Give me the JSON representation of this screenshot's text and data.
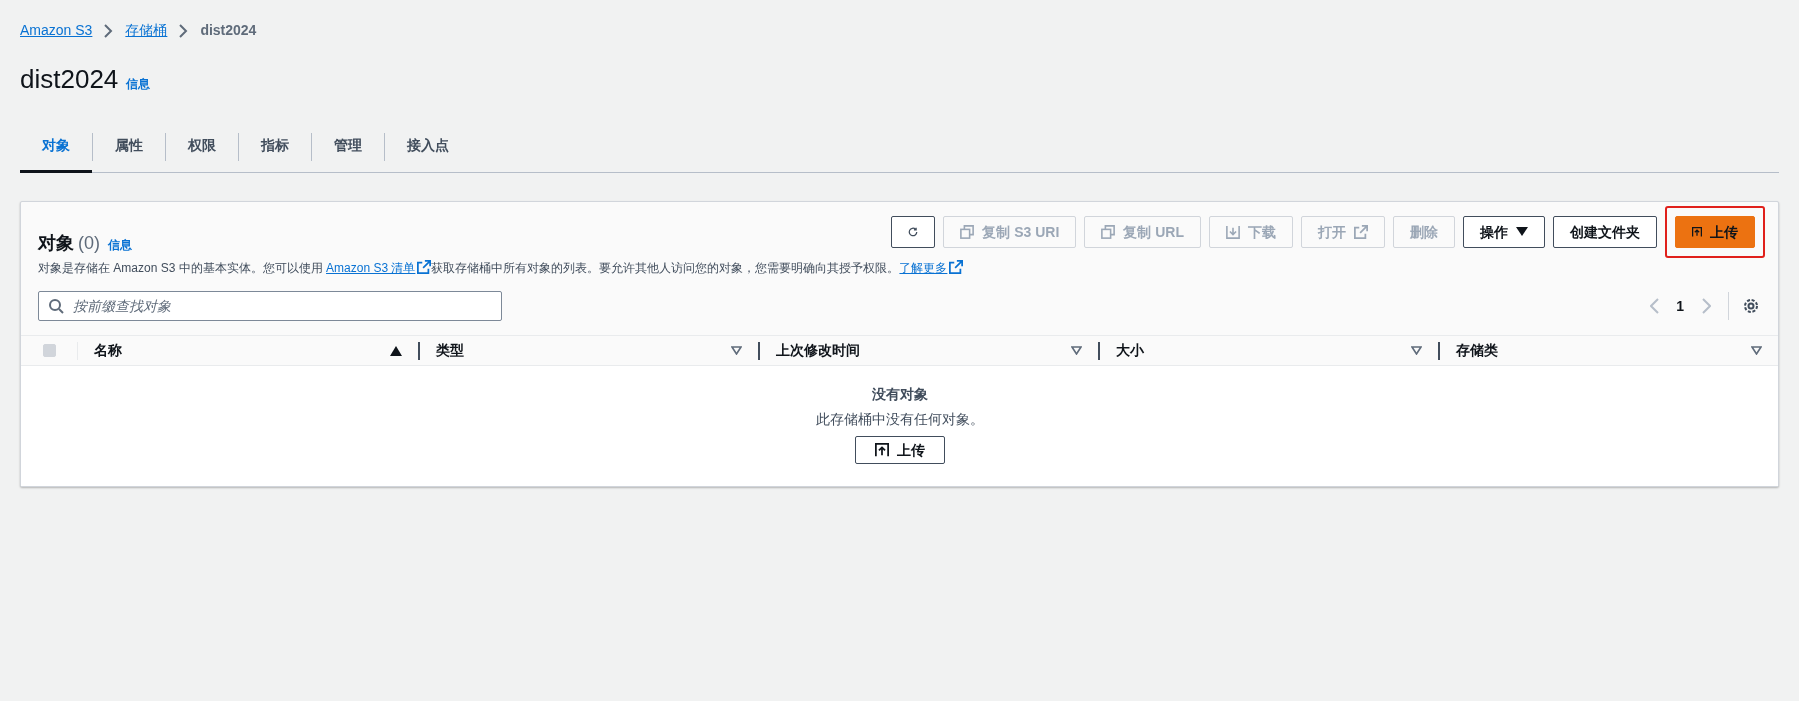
{
  "breadcrumb": [
    {
      "label": "Amazon S3",
      "kind": "link"
    },
    {
      "label": "存储桶",
      "kind": "link"
    },
    {
      "label": "dist2024",
      "kind": "current"
    }
  ],
  "page_title": "dist2024",
  "page_info_link": "信息",
  "tabs": [
    {
      "label": "对象",
      "selected": true
    },
    {
      "label": "属性",
      "selected": false
    },
    {
      "label": "权限",
      "selected": false
    },
    {
      "label": "指标",
      "selected": false
    },
    {
      "label": "管理",
      "selected": false
    },
    {
      "label": "接入点",
      "selected": false
    }
  ],
  "panel": {
    "title": "对象",
    "count": "(0)",
    "info_link": "信息",
    "description": [
      {
        "kind": "text",
        "text": "对象是存储在 Amazon S3 中的基本实体。您可以使用 "
      },
      {
        "kind": "link",
        "text": "Amazon S3 清单"
      },
      {
        "kind": "text",
        "text": "获取存储桶中所有对象的列表。要允许其他人访问您的对象，您需要明确向其授予权限。"
      },
      {
        "kind": "link",
        "text": "了解更多"
      }
    ],
    "toolbar": [
      {
        "kind": "refresh",
        "disabled": false,
        "highlighted": false
      },
      {
        "kind": "copy",
        "label": "复制 S3 URI",
        "disabled": true,
        "highlighted": false
      },
      {
        "kind": "copy",
        "label": "复制 URL",
        "disabled": true,
        "highlighted": false
      },
      {
        "kind": "download",
        "label": "下载",
        "disabled": true,
        "highlighted": false
      },
      {
        "kind": "open",
        "label": "打开",
        "disabled": true,
        "highlighted": false
      },
      {
        "kind": "plain",
        "label": "删除",
        "disabled": true,
        "highlighted": false
      },
      {
        "kind": "dropdown",
        "label": "操作",
        "disabled": false,
        "highlighted": false
      },
      {
        "kind": "plain",
        "label": "创建文件夹",
        "disabled": false,
        "highlighted": false
      },
      {
        "kind": "upload",
        "label": "上传",
        "disabled": false,
        "highlighted": true
      }
    ],
    "search": {
      "placeholder": "按前缀查找对象"
    },
    "pagination": {
      "page": "1",
      "prev_disabled": true,
      "next_disabled": true
    },
    "table": {
      "select_all": {
        "checked": false,
        "disabled": true
      },
      "columns": [
        {
          "label": "名称",
          "sorted": true
        },
        {
          "label": "类型",
          "sorted": false
        },
        {
          "label": "上次修改时间",
          "sorted": false
        },
        {
          "label": "大小",
          "sorted": false
        },
        {
          "label": "存储类",
          "sorted": false
        }
      ],
      "empty": {
        "title": "没有对象",
        "message": "此存储桶中没有任何对象。",
        "button": "上传"
      }
    }
  }
}
